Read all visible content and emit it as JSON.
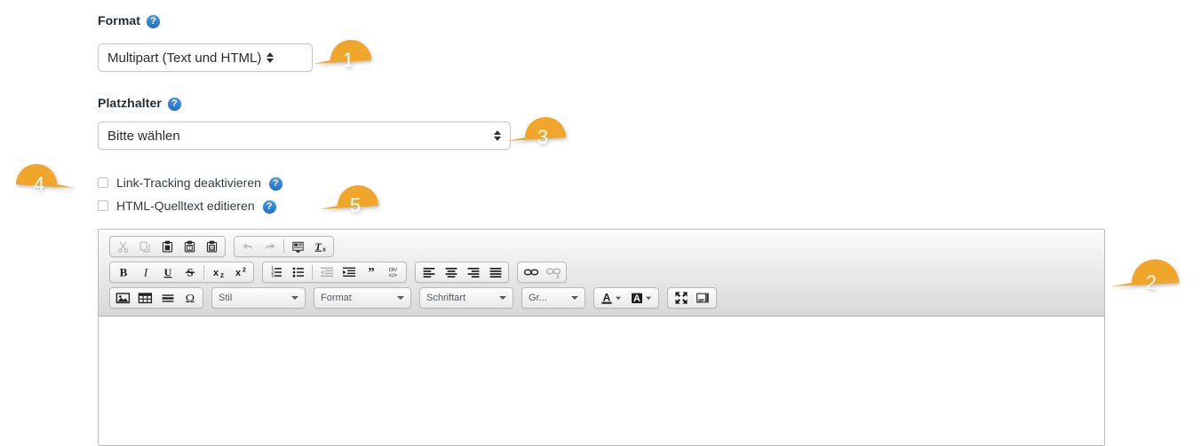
{
  "form": {
    "format_field": {
      "label": "Format",
      "help_icon": "help-icon",
      "selected": "Multipart (Text und HTML)"
    },
    "placeholder_field": {
      "label": "Platzhalter",
      "help_icon": "help-icon",
      "selected": "Bitte wählen"
    },
    "checkboxes": [
      {
        "label": "Link-Tracking deaktivieren",
        "checked": false,
        "help_icon": "help-icon"
      },
      {
        "label": "HTML-Quelltext editieren",
        "checked": false,
        "help_icon": "help-icon"
      }
    ]
  },
  "editor": {
    "toolbar_rows": [
      {
        "groups": [
          {
            "buttons": [
              {
                "icon": "cut-icon",
                "enabled": false
              },
              {
                "icon": "copy-icon",
                "enabled": false
              },
              {
                "icon": "paste-icon",
                "enabled": true
              },
              {
                "icon": "paste-as-plain-text-icon",
                "enabled": true
              },
              {
                "icon": "paste-from-word-icon",
                "enabled": true
              }
            ]
          },
          {
            "buttons": [
              {
                "icon": "undo-icon",
                "enabled": false
              },
              {
                "icon": "redo-icon",
                "enabled": false
              },
              {
                "icon": "separator",
                "enabled": false
              },
              {
                "icon": "templates-icon",
                "enabled": true
              },
              {
                "icon": "remove-format-icon",
                "enabled": true
              }
            ]
          }
        ]
      },
      {
        "groups": [
          {
            "buttons": [
              {
                "icon": "bold-icon",
                "enabled": true
              },
              {
                "icon": "italic-icon",
                "enabled": true
              },
              {
                "icon": "underline-icon",
                "enabled": true
              },
              {
                "icon": "strikethrough-icon",
                "enabled": true
              },
              {
                "icon": "separator",
                "enabled": false
              },
              {
                "icon": "subscript-icon",
                "enabled": true
              },
              {
                "icon": "superscript-icon",
                "enabled": true
              }
            ]
          },
          {
            "buttons": [
              {
                "icon": "numbered-list-icon",
                "enabled": true
              },
              {
                "icon": "bulleted-list-icon",
                "enabled": true
              },
              {
                "icon": "separator",
                "enabled": false
              },
              {
                "icon": "decrease-indent-icon",
                "enabled": false
              },
              {
                "icon": "increase-indent-icon",
                "enabled": true
              },
              {
                "icon": "blockquote-icon",
                "enabled": true
              },
              {
                "icon": "create-div-icon",
                "enabled": true
              }
            ]
          },
          {
            "buttons": [
              {
                "icon": "align-left-icon",
                "enabled": true
              },
              {
                "icon": "align-center-icon",
                "enabled": true
              },
              {
                "icon": "align-right-icon",
                "enabled": true
              },
              {
                "icon": "align-justify-icon",
                "enabled": true
              }
            ]
          },
          {
            "buttons": [
              {
                "icon": "link-icon",
                "enabled": true
              },
              {
                "icon": "unlink-icon",
                "enabled": false
              }
            ]
          }
        ]
      },
      {
        "groups": [
          {
            "buttons": [
              {
                "icon": "image-icon",
                "enabled": true
              },
              {
                "icon": "table-icon",
                "enabled": true
              },
              {
                "icon": "horizontal-rule-icon",
                "enabled": true
              },
              {
                "icon": "special-character-icon",
                "enabled": true
              }
            ]
          }
        ],
        "dropdowns": [
          {
            "name": "style-dropdown",
            "label": "Stil"
          },
          {
            "name": "format-dropdown",
            "label": "Format"
          },
          {
            "name": "font-dropdown",
            "label": "Schriftart"
          },
          {
            "name": "font-size-dropdown",
            "label": "Gr..."
          }
        ],
        "color_buttons": [
          {
            "icon": "text-color-icon",
            "enabled": true
          },
          {
            "icon": "background-color-icon",
            "enabled": true
          }
        ],
        "view_buttons": [
          {
            "icon": "maximize-icon",
            "enabled": true
          },
          {
            "icon": "show-blocks-icon",
            "enabled": true
          }
        ]
      }
    ],
    "content": ""
  },
  "callouts": [
    {
      "number": "1",
      "direction": "left"
    },
    {
      "number": "2",
      "direction": "left"
    },
    {
      "number": "3",
      "direction": "left"
    },
    {
      "number": "4",
      "direction": "right"
    },
    {
      "number": "5",
      "direction": "left"
    }
  ],
  "colors": {
    "callout": "#efa62a",
    "help_icon": "#2a7fd4",
    "toolbar_top": "#fbfbfb",
    "toolbar_bottom": "#d8d8d8",
    "editor_border": "#bdbdbd",
    "text": "#33393d"
  }
}
